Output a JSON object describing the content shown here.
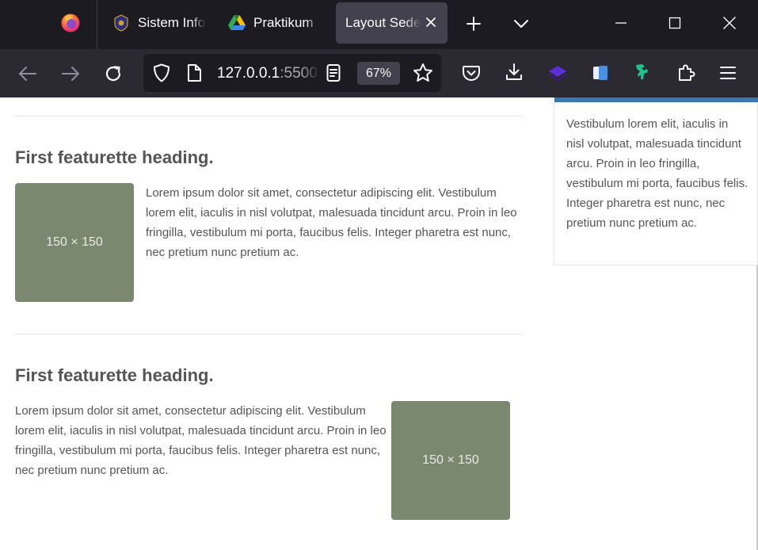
{
  "browser": {
    "tabs": [
      {
        "title": "Sistem Info",
        "favicon": "university-crest-icon"
      },
      {
        "title": "Praktikum",
        "favicon": "google-drive-icon"
      },
      {
        "title": "Layout Sederhana",
        "favicon": "none",
        "active": true
      }
    ],
    "url_host": "127.0.0.1",
    "url_port": ":5500",
    "zoom": "67%"
  },
  "colors": {
    "tabbar_bg": "#1c1b22",
    "toolbar_bg": "#2b2a33",
    "active_tab_bg": "#42414d",
    "accent_blue": "#337ab7",
    "placeholder_bg": "#7a8870",
    "body_text": "#555555"
  },
  "featurettes": [
    {
      "heading": "First featurette heading.",
      "image_label": "150 × 150",
      "text": "Lorem ipsum dolor sit amet, consectetur adipiscing elit. Vestibulum lorem elit, iaculis in nisl volutpat, malesuada tincidunt arcu. Proin in leo fringilla, vestibulum mi porta, faucibus felis. Integer pharetra est nunc, nec pretium nunc pretium ac."
    },
    {
      "heading": "First featurette heading.",
      "image_label": "150 × 150",
      "text": "Lorem ipsum dolor sit amet, consectetur adipiscing elit. Vestibulum lorem elit, iaculis in nisl volutpat, malesuada tincidunt arcu. Proin in leo fringilla, vestibulum mi porta, faucibus felis. Integer pharetra est nunc, nec pretium nunc pretium ac."
    }
  ],
  "sidebar": {
    "text": "Vestibulum lorem elit, iaculis in nisl volutpat, malesuada tincidunt arcu. Proin in leo fringilla, vestibulum mi porta, faucibus felis. Integer pharetra est nunc, nec pretium nunc pretium ac."
  }
}
